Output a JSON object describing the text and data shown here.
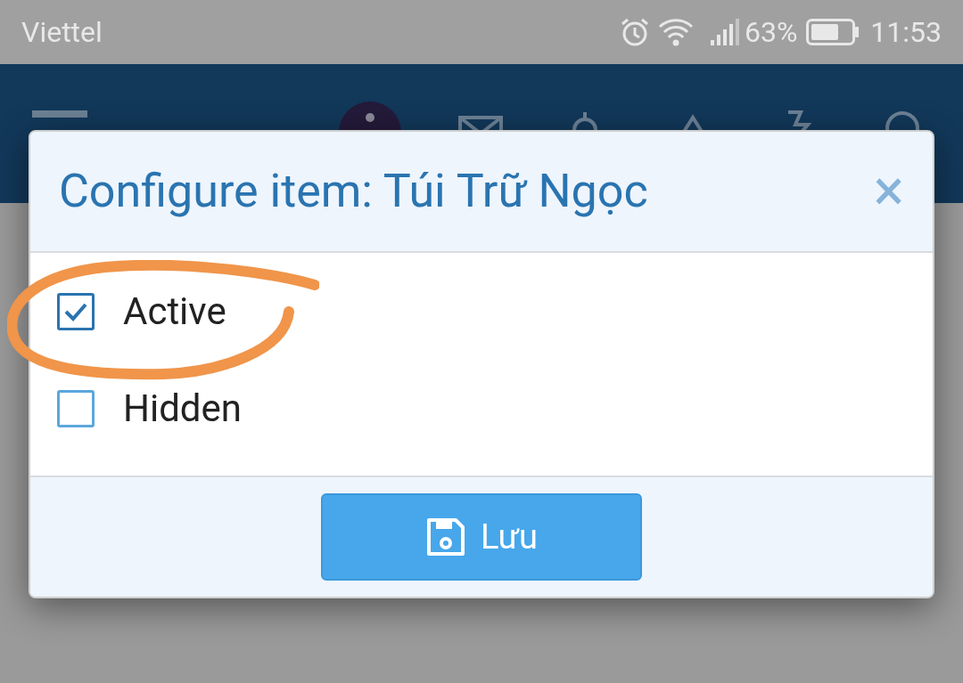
{
  "status_bar": {
    "carrier": "Viettel",
    "battery": "63%",
    "time": "11:53"
  },
  "dialog": {
    "title": "Configure item: Túi Trữ Ngọc",
    "close": "×",
    "options": [
      {
        "label": "Active",
        "checked": true
      },
      {
        "label": "Hidden",
        "checked": false
      }
    ],
    "save_button": "Lưu"
  }
}
